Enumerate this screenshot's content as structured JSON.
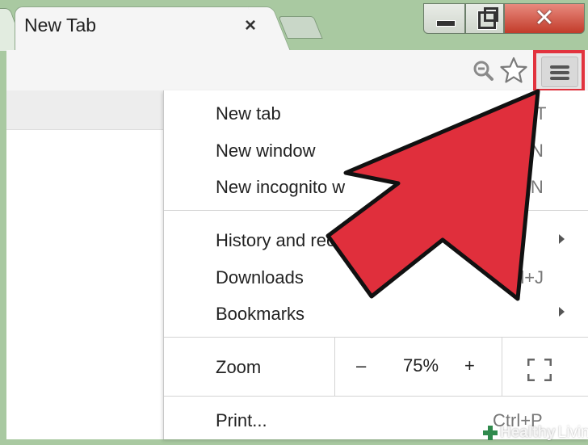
{
  "browser": {
    "tab": {
      "title": "New Tab",
      "close_glyph": "×"
    },
    "window_controls": {
      "close_glyph": "✕"
    },
    "toolbar": {
      "icons": [
        "zoom-out-icon",
        "bookmark-star-icon",
        "hamburger-menu-icon"
      ]
    }
  },
  "menu": {
    "group1": [
      {
        "label": "New tab",
        "shortcut": "T"
      },
      {
        "label": "New window",
        "shortcut": "N"
      },
      {
        "label": "New incognito w",
        "shortcut": "+N"
      }
    ],
    "group2": [
      {
        "label": "History and recent tab",
        "submenu": true
      },
      {
        "label": "Downloads",
        "shortcut": "Ctrl+J"
      },
      {
        "label": "Bookmarks",
        "submenu": true
      }
    ],
    "zoom": {
      "label": "Zoom",
      "minus": "–",
      "value": "75%",
      "plus": "+"
    },
    "group3": [
      {
        "label": "Print...",
        "shortcut": "Ctrl+P"
      }
    ]
  },
  "annotation": {
    "highlight_color": "#e2333e",
    "arrow_fill": "#e02f3c"
  },
  "watermark": {
    "bold": "Healthy",
    "regular": "Living"
  }
}
